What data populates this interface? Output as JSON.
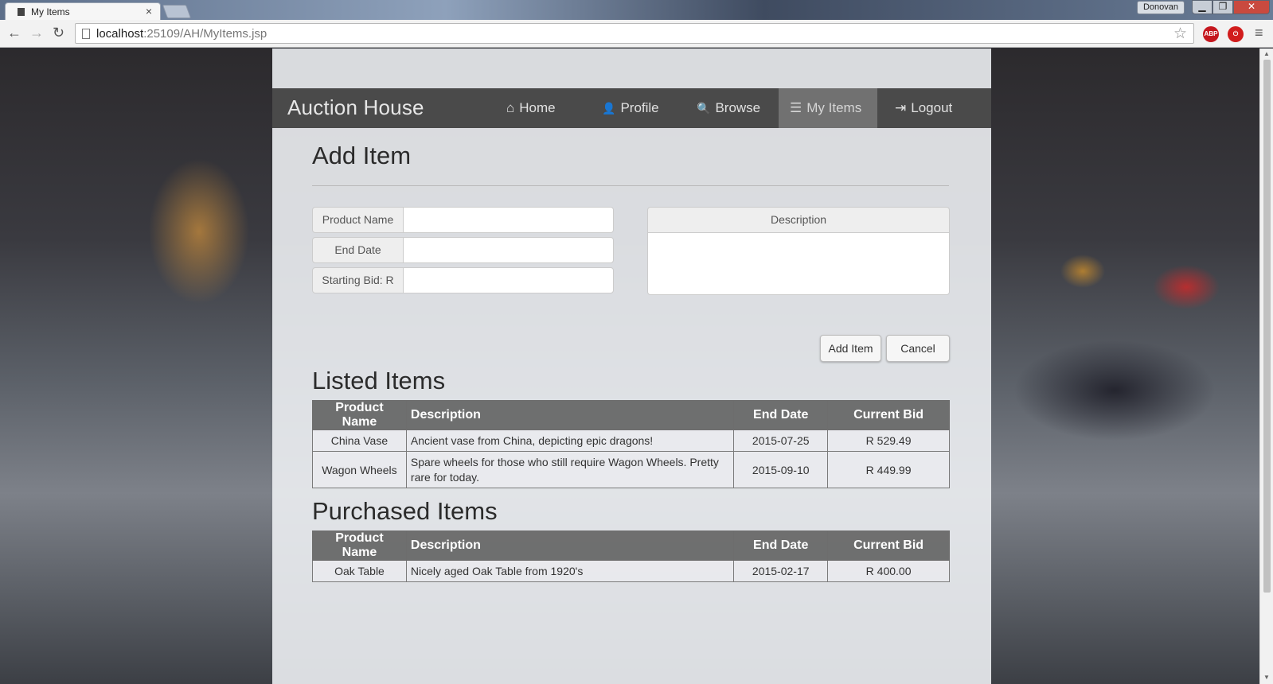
{
  "browser": {
    "tab_title": "My Items",
    "tab_close": "×",
    "url_host": "localhost",
    "url_rest": ":25109/AH/MyItems.jsp",
    "user_label": "Donovan",
    "ext_abp": "ABP",
    "win_min": "▁",
    "win_max": "❐",
    "win_close": "✕",
    "back": "←",
    "forward": "→",
    "reload": "↻",
    "star": "☆",
    "menu": "≡"
  },
  "navbar": {
    "brand": "Auction House",
    "items": [
      {
        "label": "Home",
        "icon": "home-icon",
        "glyph": "⌂"
      },
      {
        "label": "Profile",
        "icon": "user-icon",
        "glyph": "👤"
      },
      {
        "label": "Browse",
        "icon": "search-icon",
        "glyph": "🔍"
      },
      {
        "label": "My Items",
        "icon": "list-icon",
        "glyph": "☰"
      },
      {
        "label": "Logout",
        "icon": "logout-icon",
        "glyph": "⇥"
      }
    ],
    "active": "My Items"
  },
  "add_item": {
    "heading": "Add Item",
    "fields": [
      {
        "label": "Product Name",
        "value": ""
      },
      {
        "label": "End Date",
        "value": ""
      },
      {
        "label": "Starting Bid: R",
        "value": ""
      }
    ],
    "description_label": "Description",
    "description_value": "",
    "add_button": "Add Item",
    "cancel_button": "Cancel"
  },
  "listed": {
    "heading": "Listed Items",
    "columns": [
      "Product Name",
      "Description",
      "End Date",
      "Current Bid"
    ],
    "rows": [
      [
        "China Vase",
        "Ancient vase from China, depicting epic dragons!",
        "2015-07-25",
        "R 529.49"
      ],
      [
        "Wagon Wheels",
        "Spare wheels for those who still require Wagon Wheels. Pretty rare for today.",
        "2015-09-10",
        "R 449.99"
      ]
    ]
  },
  "purchased": {
    "heading": "Purchased Items",
    "columns": [
      "Product Name",
      "Description",
      "End Date",
      "Current Bid"
    ],
    "rows": [
      [
        "Oak Table",
        "Nicely aged Oak Table from 1920's",
        "2015-02-17",
        "R 400.00"
      ]
    ]
  },
  "colors": {
    "navbar_bg": "#3e3e3e",
    "navbar_active": "#787878",
    "table_header": "#5f5f5f"
  }
}
